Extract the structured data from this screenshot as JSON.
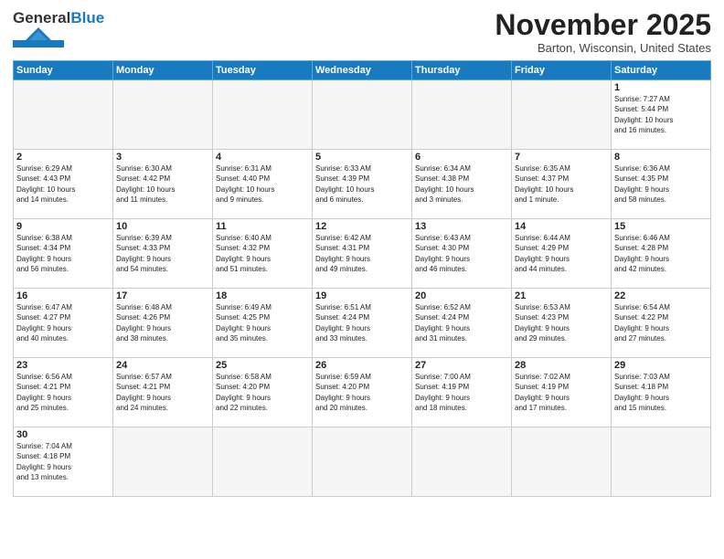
{
  "header": {
    "logo": {
      "general": "General",
      "blue": "Blue"
    },
    "month_title": "November 2025",
    "location": "Barton, Wisconsin, United States"
  },
  "days_of_week": [
    "Sunday",
    "Monday",
    "Tuesday",
    "Wednesday",
    "Thursday",
    "Friday",
    "Saturday"
  ],
  "weeks": [
    [
      {
        "day": "",
        "info": ""
      },
      {
        "day": "",
        "info": ""
      },
      {
        "day": "",
        "info": ""
      },
      {
        "day": "",
        "info": ""
      },
      {
        "day": "",
        "info": ""
      },
      {
        "day": "",
        "info": ""
      },
      {
        "day": "1",
        "info": "Sunrise: 7:27 AM\nSunset: 5:44 PM\nDaylight: 10 hours\nand 16 minutes."
      }
    ],
    [
      {
        "day": "2",
        "info": "Sunrise: 6:29 AM\nSunset: 4:43 PM\nDaylight: 10 hours\nand 14 minutes."
      },
      {
        "day": "3",
        "info": "Sunrise: 6:30 AM\nSunset: 4:42 PM\nDaylight: 10 hours\nand 11 minutes."
      },
      {
        "day": "4",
        "info": "Sunrise: 6:31 AM\nSunset: 4:40 PM\nDaylight: 10 hours\nand 9 minutes."
      },
      {
        "day": "5",
        "info": "Sunrise: 6:33 AM\nSunset: 4:39 PM\nDaylight: 10 hours\nand 6 minutes."
      },
      {
        "day": "6",
        "info": "Sunrise: 6:34 AM\nSunset: 4:38 PM\nDaylight: 10 hours\nand 3 minutes."
      },
      {
        "day": "7",
        "info": "Sunrise: 6:35 AM\nSunset: 4:37 PM\nDaylight: 10 hours\nand 1 minute."
      },
      {
        "day": "8",
        "info": "Sunrise: 6:36 AM\nSunset: 4:35 PM\nDaylight: 9 hours\nand 58 minutes."
      }
    ],
    [
      {
        "day": "9",
        "info": "Sunrise: 6:38 AM\nSunset: 4:34 PM\nDaylight: 9 hours\nand 56 minutes."
      },
      {
        "day": "10",
        "info": "Sunrise: 6:39 AM\nSunset: 4:33 PM\nDaylight: 9 hours\nand 54 minutes."
      },
      {
        "day": "11",
        "info": "Sunrise: 6:40 AM\nSunset: 4:32 PM\nDaylight: 9 hours\nand 51 minutes."
      },
      {
        "day": "12",
        "info": "Sunrise: 6:42 AM\nSunset: 4:31 PM\nDaylight: 9 hours\nand 49 minutes."
      },
      {
        "day": "13",
        "info": "Sunrise: 6:43 AM\nSunset: 4:30 PM\nDaylight: 9 hours\nand 46 minutes."
      },
      {
        "day": "14",
        "info": "Sunrise: 6:44 AM\nSunset: 4:29 PM\nDaylight: 9 hours\nand 44 minutes."
      },
      {
        "day": "15",
        "info": "Sunrise: 6:46 AM\nSunset: 4:28 PM\nDaylight: 9 hours\nand 42 minutes."
      }
    ],
    [
      {
        "day": "16",
        "info": "Sunrise: 6:47 AM\nSunset: 4:27 PM\nDaylight: 9 hours\nand 40 minutes."
      },
      {
        "day": "17",
        "info": "Sunrise: 6:48 AM\nSunset: 4:26 PM\nDaylight: 9 hours\nand 38 minutes."
      },
      {
        "day": "18",
        "info": "Sunrise: 6:49 AM\nSunset: 4:25 PM\nDaylight: 9 hours\nand 35 minutes."
      },
      {
        "day": "19",
        "info": "Sunrise: 6:51 AM\nSunset: 4:24 PM\nDaylight: 9 hours\nand 33 minutes."
      },
      {
        "day": "20",
        "info": "Sunrise: 6:52 AM\nSunset: 4:24 PM\nDaylight: 9 hours\nand 31 minutes."
      },
      {
        "day": "21",
        "info": "Sunrise: 6:53 AM\nSunset: 4:23 PM\nDaylight: 9 hours\nand 29 minutes."
      },
      {
        "day": "22",
        "info": "Sunrise: 6:54 AM\nSunset: 4:22 PM\nDaylight: 9 hours\nand 27 minutes."
      }
    ],
    [
      {
        "day": "23",
        "info": "Sunrise: 6:56 AM\nSunset: 4:21 PM\nDaylight: 9 hours\nand 25 minutes."
      },
      {
        "day": "24",
        "info": "Sunrise: 6:57 AM\nSunset: 4:21 PM\nDaylight: 9 hours\nand 24 minutes."
      },
      {
        "day": "25",
        "info": "Sunrise: 6:58 AM\nSunset: 4:20 PM\nDaylight: 9 hours\nand 22 minutes."
      },
      {
        "day": "26",
        "info": "Sunrise: 6:59 AM\nSunset: 4:20 PM\nDaylight: 9 hours\nand 20 minutes."
      },
      {
        "day": "27",
        "info": "Sunrise: 7:00 AM\nSunset: 4:19 PM\nDaylight: 9 hours\nand 18 minutes."
      },
      {
        "day": "28",
        "info": "Sunrise: 7:02 AM\nSunset: 4:19 PM\nDaylight: 9 hours\nand 17 minutes."
      },
      {
        "day": "29",
        "info": "Sunrise: 7:03 AM\nSunset: 4:18 PM\nDaylight: 9 hours\nand 15 minutes."
      }
    ],
    [
      {
        "day": "30",
        "info": "Sunrise: 7:04 AM\nSunset: 4:18 PM\nDaylight: 9 hours\nand 13 minutes."
      },
      {
        "day": "",
        "info": ""
      },
      {
        "day": "",
        "info": ""
      },
      {
        "day": "",
        "info": ""
      },
      {
        "day": "",
        "info": ""
      },
      {
        "day": "",
        "info": ""
      },
      {
        "day": "",
        "info": ""
      }
    ]
  ]
}
